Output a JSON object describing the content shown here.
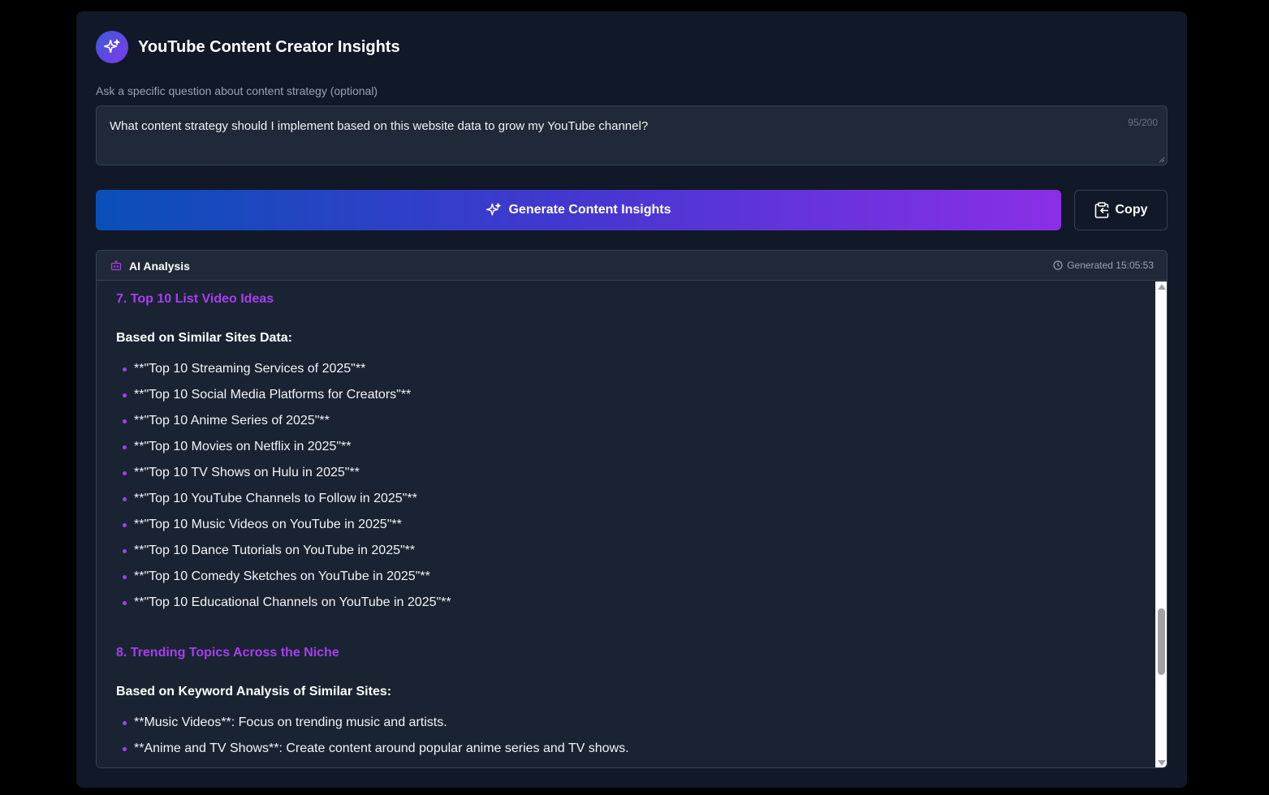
{
  "header": {
    "title": "YouTube Content Creator Insights",
    "logo_icon": "sparkles-icon"
  },
  "question": {
    "label": "Ask a specific question about content strategy (optional)",
    "value": "What content strategy should I implement based on this website data to grow my YouTube channel?",
    "char_count": "95/200"
  },
  "actions": {
    "generate_label": "Generate Content Insights",
    "copy_label": "Copy"
  },
  "analysis": {
    "title": "AI Analysis",
    "generated": "Generated 15:05:53",
    "sections": [
      {
        "heading": "7. Top 10 List Video Ideas",
        "subheading": "Based on Similar Sites Data:",
        "items": [
          "**\"Top 10 Streaming Services of 2025\"**",
          "**\"Top 10 Social Media Platforms for Creators\"**",
          "**\"Top 10 Anime Series of 2025\"**",
          "**\"Top 10 Movies on Netflix in 2025\"**",
          "**\"Top 10 TV Shows on Hulu in 2025\"**",
          "**\"Top 10 YouTube Channels to Follow in 2025\"**",
          "**\"Top 10 Music Videos on YouTube in 2025\"**",
          "**\"Top 10 Dance Tutorials on YouTube in 2025\"**",
          "**\"Top 10 Comedy Sketches on YouTube in 2025\"**",
          "**\"Top 10 Educational Channels on YouTube in 2025\"**"
        ]
      },
      {
        "heading": "8. Trending Topics Across the Niche",
        "subheading": "Based on Keyword Analysis of Similar Sites:",
        "items": [
          "**Music Videos**: Focus on trending music and artists.",
          "**Anime and TV Shows**: Create content around popular anime series and TV shows."
        ]
      }
    ]
  },
  "colors": {
    "accent": "#a73ef0",
    "gradient_start": "#0a4fb8",
    "gradient_end": "#8b2fe6",
    "panel_bg": "#111827"
  }
}
